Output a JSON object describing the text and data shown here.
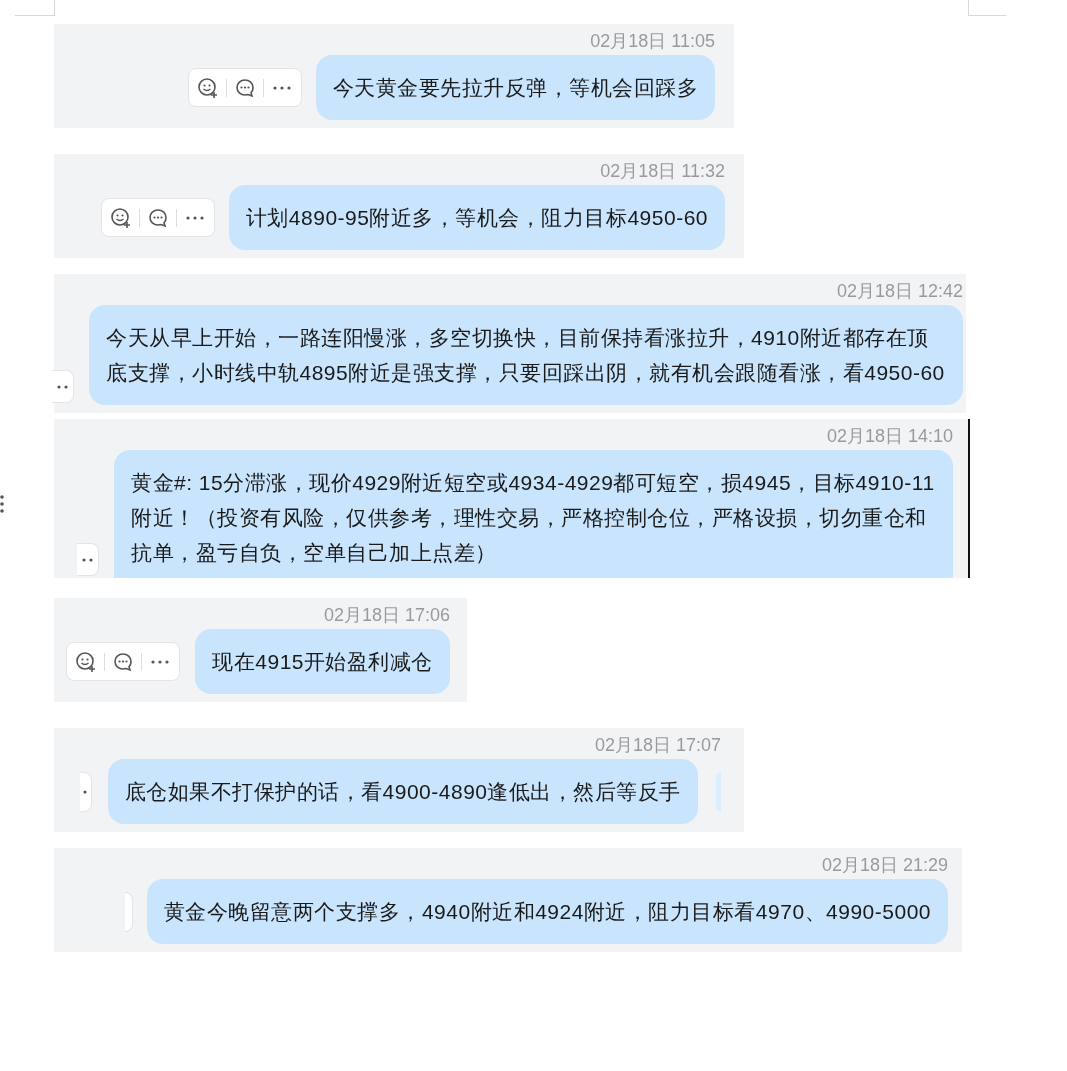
{
  "messages": [
    {
      "time": "02月18日 11:05",
      "text": "今天黄金要先拉升反弹，等机会回踩多",
      "kind": "full",
      "side_menu": false
    },
    {
      "time": "02月18日 11:32",
      "text": "计划4890-95附近多，等机会，阻力目标4950-60",
      "kind": "full",
      "side_menu": false
    },
    {
      "time": "02月18日 12:42",
      "text": "今天从早上开始，一路连阳慢涨，多空切换快，目前保持看涨拉升，4910附近都存在顶底支撑，小时线中轨4895附近是强支撑，只要回踩出阴，就有机会跟随看涨，看4950-60",
      "kind": "dots",
      "side_menu": false
    },
    {
      "time": "02月18日 14:10",
      "text": "黄金#: 15分滞涨，现价4929附近短空或4934-4929都可短空，损4945，目标4910-11附近！（投资有风险，仅供参考，理性交易，严格控制仓位，严格设损，切勿重仓和抗单，盈亏自负，空单自己加上点差）",
      "kind": "dots",
      "side_menu": true
    },
    {
      "time": "02月18日 17:06",
      "text": "现在4915开始盈利减仓",
      "kind": "full",
      "side_menu": false
    },
    {
      "time": "02月18日 17:07",
      "text": "底仓如果不打保护的话，看4900-4890逢低出，然后等反手",
      "kind": "dot",
      "side_menu": false
    },
    {
      "time": "02月18日 21:29",
      "text": "黄金今晚留意两个支撑多，4940附近和4924附近，阻力目标看4970、4990-5000",
      "kind": "edge",
      "side_menu": false
    }
  ]
}
